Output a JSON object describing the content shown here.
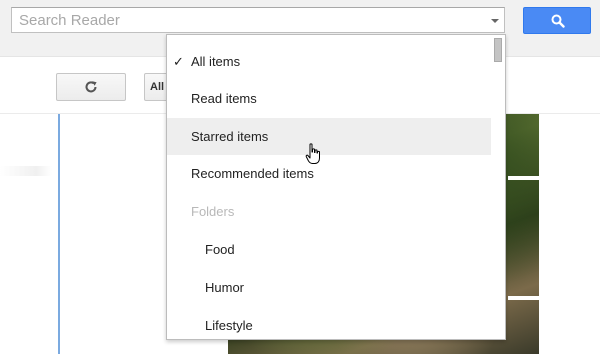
{
  "search": {
    "placeholder": "Search Reader"
  },
  "toolbar": {
    "view_label": "All"
  },
  "dropdown": {
    "items": [
      {
        "label": "All items",
        "checked": true
      },
      {
        "label": "Read items"
      },
      {
        "label": "Starred items",
        "hovered": true
      },
      {
        "label": "Recommended items"
      }
    ],
    "folders_header": "Folders",
    "folders": [
      {
        "label": "Food"
      },
      {
        "label": "Humor"
      },
      {
        "label": "Lifestyle"
      }
    ]
  },
  "icons": {
    "search_button": "magnifier-icon",
    "refresh_button": "refresh-icon",
    "selected_item": "checkmark-icon",
    "search_dropdown": "caret-down-icon",
    "cursor": "hand-pointer-icon"
  },
  "colors": {
    "accent_button": "#4a8af4",
    "hover_row": "#eeeeee",
    "divider": "#7baae0"
  }
}
